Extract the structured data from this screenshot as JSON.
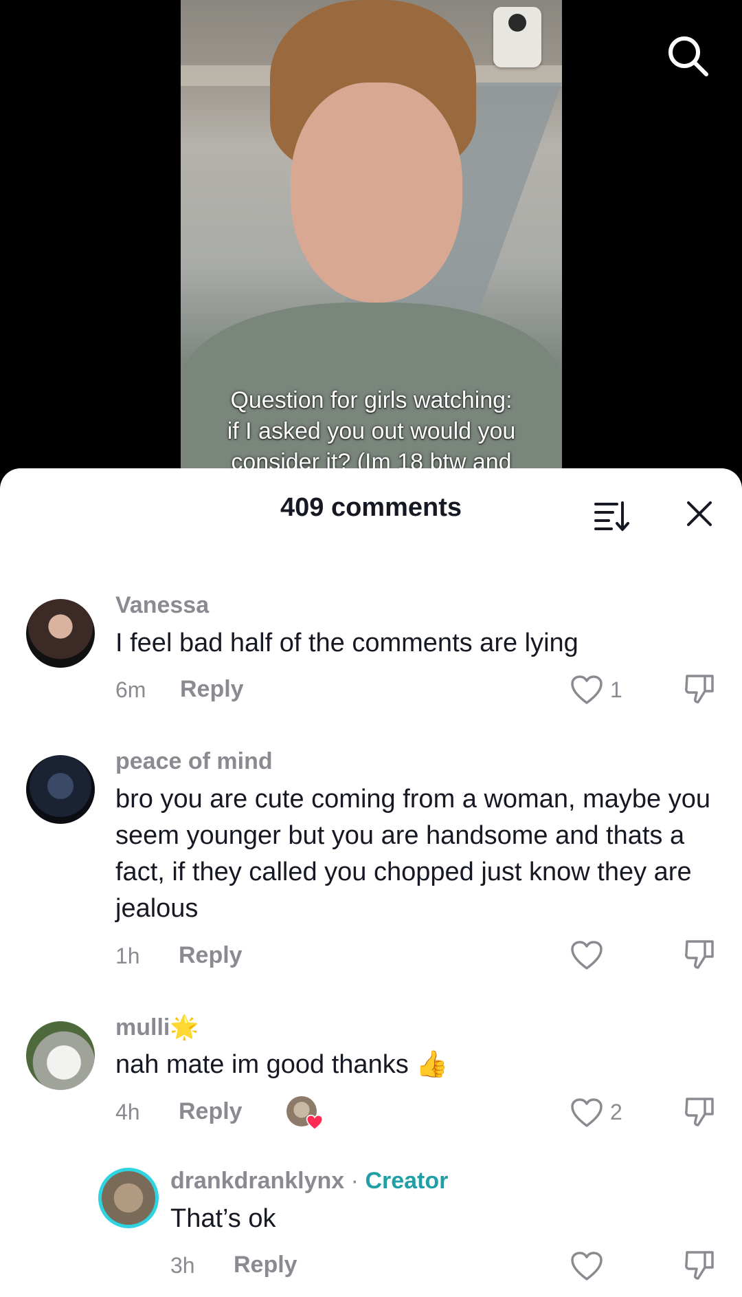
{
  "video": {
    "caption_lines": [
      "Question for girls watching:",
      "if I asked you out would you",
      "consider it? (Im 18 btw and"
    ]
  },
  "sheet": {
    "title": "409 comments"
  },
  "comments": [
    {
      "username": "Vanessa",
      "text": "I feel bad half of the comments are lying",
      "time": "6m",
      "reply_label": "Reply",
      "like_count": "1"
    },
    {
      "username": "peace of mind",
      "text": "bro you are cute coming from a woman, maybe you seem younger but you are handsome and thats a fact, if they called you chopped just know they are jealous",
      "time": "1h",
      "reply_label": "Reply",
      "like_count": ""
    },
    {
      "username": "mulli",
      "username_emoji": "🌟",
      "text": "nah mate im good thanks",
      "text_emoji": "👍",
      "time": "4h",
      "reply_label": "Reply",
      "like_count": "2"
    }
  ],
  "reply": {
    "username": "drankdranklynx",
    "separator": "·",
    "creator_label": "Creator",
    "text": "That’s ok",
    "time": "3h",
    "reply_label": "Reply"
  },
  "colors": {
    "sheet_bg": "#ffffff",
    "text_primary": "#161823",
    "text_secondary": "#8a8b91",
    "creator_accent": "#20a0a6",
    "heart_red": "#fe2c55"
  },
  "icons": [
    "search-icon",
    "sort-icon",
    "close-icon",
    "heart-outline-icon",
    "thumbs-down-icon"
  ]
}
